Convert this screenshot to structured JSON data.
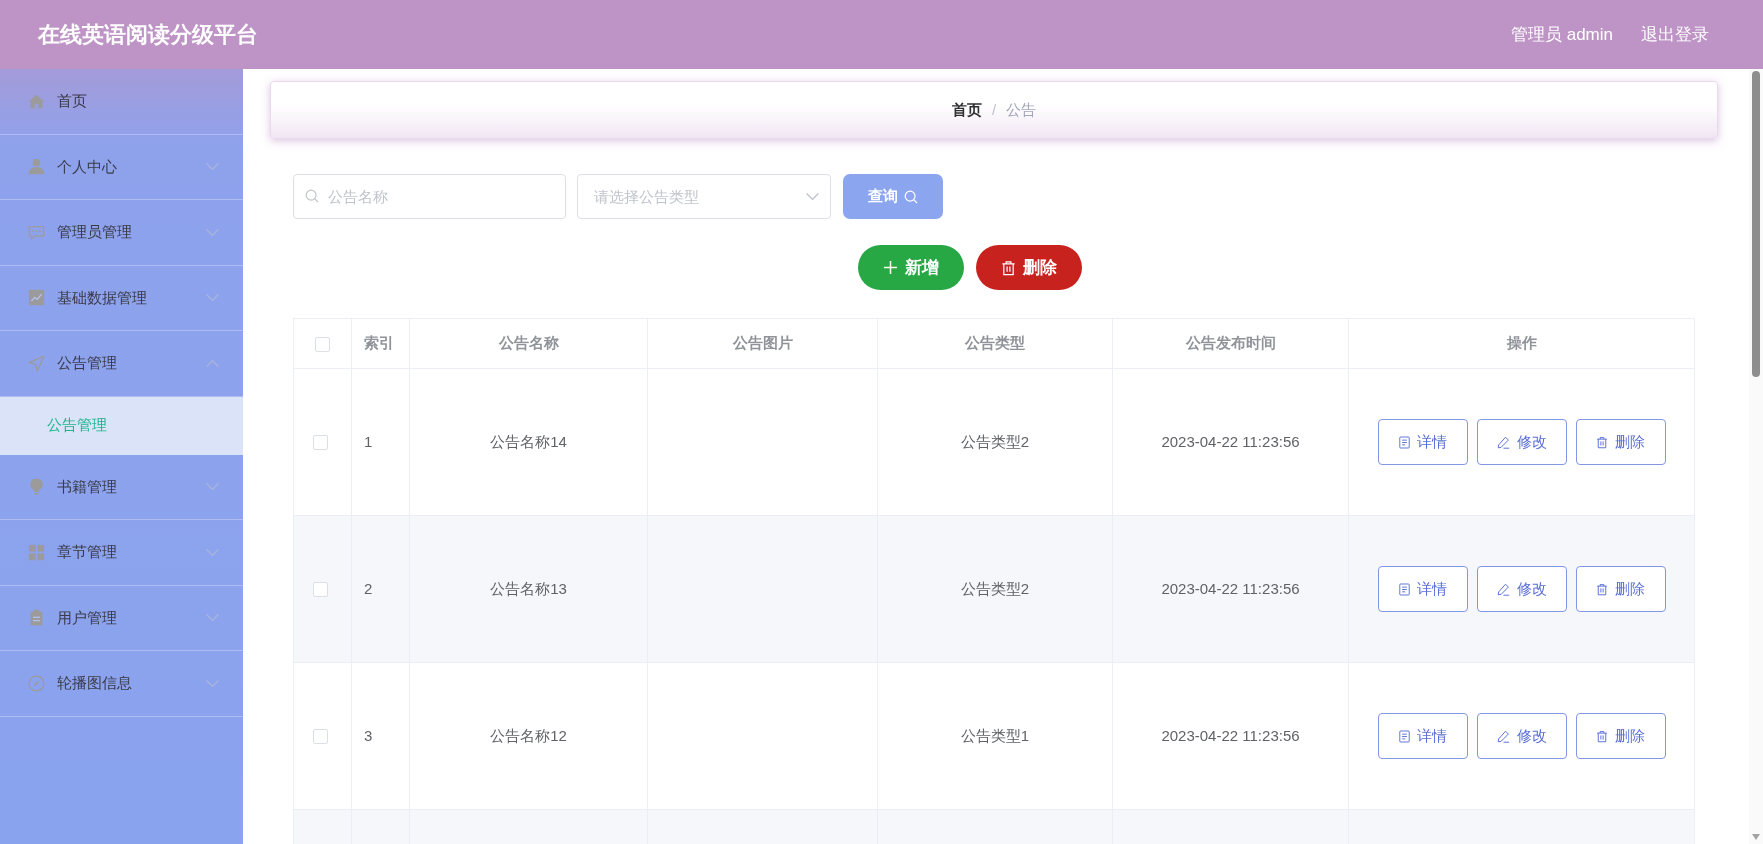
{
  "header": {
    "title": "在线英语阅读分级平台",
    "user": "管理员 admin",
    "logout": "退出登录"
  },
  "sidebar": {
    "items": [
      {
        "kind": "link",
        "label": "首页"
      },
      {
        "kind": "menu",
        "label": "个人中心",
        "expanded": false
      },
      {
        "kind": "menu",
        "label": "管理员管理",
        "expanded": false
      },
      {
        "kind": "menu",
        "label": "基础数据管理",
        "expanded": false
      },
      {
        "kind": "menu",
        "label": "公告管理",
        "expanded": true,
        "children": [
          {
            "label": "公告管理",
            "selected": true
          }
        ]
      },
      {
        "kind": "menu",
        "label": "书籍管理",
        "expanded": false
      },
      {
        "kind": "menu",
        "label": "章节管理",
        "expanded": false
      },
      {
        "kind": "menu",
        "label": "用户管理",
        "expanded": false
      },
      {
        "kind": "menu",
        "label": "轮播图信息",
        "expanded": false
      }
    ]
  },
  "breadcrumb": {
    "items": [
      {
        "label": "首页",
        "current": false
      },
      {
        "label": "公告",
        "current": true
      }
    ],
    "separator": "/"
  },
  "search": {
    "name_field": {
      "placeholder": "公告名称"
    },
    "type_select": {
      "placeholder": "请选择公告类型"
    },
    "query_button": "查询"
  },
  "actions": [
    {
      "kind": "add",
      "label": "新增"
    },
    {
      "kind": "delete",
      "label": "删除"
    }
  ],
  "table": {
    "select_all": {
      "checked": false
    },
    "columns": [
      "索引",
      "公告名称",
      "公告图片",
      "公告类型",
      "公告发布时间",
      "操作"
    ],
    "rows": [
      {
        "checked": false,
        "index": "1",
        "name": "公告名称14",
        "type": "公告类型2",
        "time": "2023-04-22 11:23:56",
        "actions": [
          {
            "kind": "detail",
            "label": "详情"
          },
          {
            "kind": "edit",
            "label": "修改"
          },
          {
            "kind": "delete",
            "label": "删除"
          }
        ]
      },
      {
        "checked": false,
        "index": "2",
        "name": "公告名称13",
        "type": "公告类型2",
        "time": "2023-04-22 11:23:56",
        "actions": [
          {
            "kind": "detail",
            "label": "详情"
          },
          {
            "kind": "edit",
            "label": "修改"
          },
          {
            "kind": "delete",
            "label": "删除"
          }
        ]
      },
      {
        "checked": false,
        "index": "3",
        "name": "公告名称12",
        "type": "公告类型1",
        "time": "2023-04-22 11:23:56",
        "actions": [
          {
            "kind": "detail",
            "label": "详情"
          },
          {
            "kind": "edit",
            "label": "修改"
          },
          {
            "kind": "delete",
            "label": "删除"
          }
        ]
      }
    ]
  }
}
